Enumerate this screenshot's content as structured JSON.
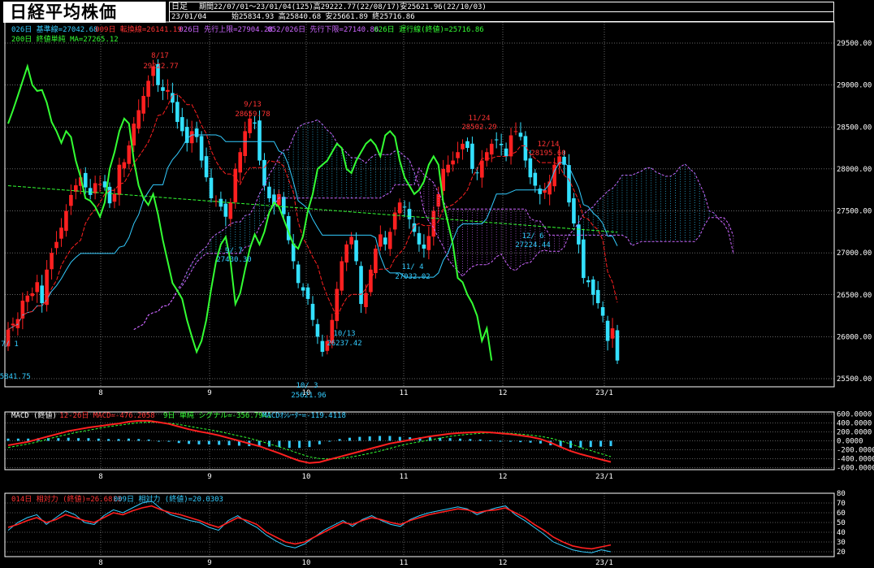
{
  "header": {
    "title": "日経平均株価",
    "period_type": "日足",
    "period_info": "期間22/07/01～23/01/04(125)高29222.77(22/08/17)安25621.96(22/10/03)",
    "date": "23/01/04",
    "ohlc": "始25834.93 高25840.68 安25661.89 終25716.86"
  },
  "legend_main": [
    {
      "text": "026日 基準線=27042.68",
      "color": "#33ccff"
    },
    {
      "text": "009日 転換線=26141.19",
      "color": "#ff3333"
    },
    {
      "text": "026日 先行上限=27904.28",
      "color": "#cc66ff"
    },
    {
      "text": "052/026日 先行下限=27140.86",
      "color": "#cc66ff"
    },
    {
      "text": "026日 遅行線(終値)=25716.86",
      "color": "#33ff33"
    },
    {
      "text": "200日 終値単純 MA=27265.12",
      "color": "#33ff33"
    }
  ],
  "legend_macd": [
    {
      "text": "MACD (終値)",
      "color": "#ffffff"
    },
    {
      "text": "12-26日 MACD=-476.2058",
      "color": "#ff3333"
    },
    {
      "text": "9日 単純 シグナル=-356.7941",
      "color": "#33ff33"
    },
    {
      "text": "MACDｵｼﾚｰﾀｰ=-119.4118",
      "color": "#33ccff"
    }
  ],
  "legend_rsi": [
    {
      "text": "014日 相対力 (終値)=26.6813",
      "color": "#ff3333"
    },
    {
      "text": "009日 相対力 (終値)=20.0303",
      "color": "#33ccff"
    }
  ],
  "colors": {
    "up": "#ff2020",
    "down": "#33e0ff",
    "kijun": "#33ccff",
    "tenkan": "#ff2020",
    "span_a": "#cc66ff",
    "span_b": "#cc66ff",
    "chikou": "#33ff33",
    "ma": "#33ff33",
    "grid": "#ffffff"
  },
  "chart_data": {
    "type": "candlestick",
    "y_axis": {
      "min": 25500,
      "max": 29500,
      "ticks": [
        "29500.00",
        "29000.00",
        "28500.00",
        "28000.00",
        "27500.00",
        "27000.00",
        "26500.00",
        "26000.00",
        "25500.00"
      ]
    },
    "x_ticks": [
      "8",
      "9",
      "10",
      "11",
      "12",
      "23/1"
    ],
    "annotations": [
      {
        "date_label": "8/17",
        "value_label": "29222.77",
        "color": "#ff3333"
      },
      {
        "date_label": "9/13",
        "value_label": "28659.78",
        "color": "#ff3333"
      },
      {
        "date_label": "11/24",
        "value_label": "28502.29",
        "color": "#ff3333"
      },
      {
        "date_label": "12/14",
        "value_label": "28195.60",
        "color": "#ff3333"
      },
      {
        "date_label": "9/ 7",
        "value_label": "27430.30",
        "color": "#33ccff"
      },
      {
        "date_label": "10/13",
        "value_label": "26237.42",
        "color": "#33ccff"
      },
      {
        "date_label": "10/ 3",
        "value_label": "25621.96",
        "color": "#33ccff"
      },
      {
        "date_label": "11/ 4",
        "value_label": "27032.02",
        "color": "#33ccff"
      },
      {
        "date_label": "12/ 6",
        "value_label": "27224.44",
        "color": "#33ccff"
      },
      {
        "date_label": "7/ 1",
        "value_label": "25841.75",
        "color": "#33ccff"
      }
    ],
    "closes": [
      26085,
      26155,
      26210,
      26430,
      26490,
      26517,
      26650,
      26400,
      26800,
      27000,
      27130,
      27300,
      27500,
      27690,
      27805,
      27900,
      27780,
      27690,
      27830,
      27820,
      27780,
      27590,
      27700,
      28050,
      28080,
      28280,
      28540,
      28700,
      28870,
      29050,
      29222,
      29000,
      28930,
      28940,
      28790,
      28560,
      28450,
      28310,
      28450,
      28380,
      28100,
      27900,
      27650,
      27620,
      27550,
      27430,
      27600,
      28000,
      28200,
      28450,
      28600,
      28540,
      28100,
      27800,
      27650,
      27570,
      27700,
      27460,
      27150,
      26900,
      26640,
      26550,
      26450,
      26200,
      26000,
      25820,
      25950,
      26200,
      26570,
      26900,
      27100,
      27190,
      26900,
      26390,
      26520,
      26800,
      27050,
      27220,
      27100,
      27250,
      27480,
      27600,
      27550,
      27400,
      27250,
      27100,
      27050,
      27200,
      27500,
      27700,
      28000,
      28050,
      28100,
      28200,
      28300,
      28250,
      28000,
      27950,
      28100,
      28200,
      28300,
      28350,
      28283,
      28150,
      28400,
      28450,
      28383,
      28100,
      27900,
      27800,
      27700,
      27750,
      27850,
      28050,
      28150,
      28050,
      27600,
      27350,
      27100,
      26700,
      26650,
      26500,
      26400,
      26250,
      25950,
      26100,
      25716
    ]
  },
  "macd_chart": {
    "ticks": [
      "600.0000",
      "400.0000",
      "200.0000",
      "0.0000",
      "-200.0000",
      "-400.0000",
      "-600.0000"
    ],
    "min": -650,
    "max": 650,
    "macd": [
      -100,
      -60,
      -20,
      40,
      100,
      160,
      220,
      260,
      300,
      330,
      360,
      390,
      430,
      450,
      450,
      420,
      380,
      320,
      260,
      210,
      170,
      120,
      60,
      0,
      -60,
      -120,
      -200,
      -280,
      -370,
      -450,
      -500,
      -480,
      -420,
      -360,
      -300,
      -240,
      -180,
      -120,
      -60,
      -20,
      20,
      60,
      100,
      130,
      160,
      180,
      190,
      200,
      190,
      170,
      150,
      120,
      90,
      40,
      -40,
      -140,
      -230,
      -300,
      -360,
      -420,
      -476
    ],
    "signal": [
      -150,
      -110,
      -70,
      -20,
      40,
      100,
      150,
      200,
      240,
      280,
      320,
      350,
      380,
      410,
      420,
      420,
      400,
      370,
      330,
      290,
      250,
      210,
      160,
      110,
      60,
      0,
      -70,
      -140,
      -210,
      -290,
      -360,
      -400,
      -410,
      -400,
      -370,
      -330,
      -280,
      -230,
      -170,
      -110,
      -60,
      -20,
      20,
      60,
      100,
      130,
      150,
      170,
      180,
      180,
      170,
      150,
      130,
      100,
      60,
      0,
      -70,
      -150,
      -220,
      -290,
      -356
    ]
  },
  "rsi_chart": {
    "ticks": [
      "80",
      "70",
      "60",
      "50",
      "40",
      "30",
      "20"
    ],
    "min": 15,
    "max": 80,
    "rsi14": [
      45,
      48,
      52,
      55,
      50,
      53,
      58,
      55,
      52,
      50,
      55,
      60,
      58,
      62,
      65,
      67,
      63,
      60,
      58,
      55,
      52,
      48,
      45,
      50,
      55,
      52,
      48,
      40,
      35,
      30,
      28,
      30,
      35,
      40,
      45,
      50,
      48,
      52,
      55,
      53,
      50,
      48,
      52,
      55,
      58,
      60,
      62,
      64,
      63,
      60,
      62,
      63,
      65,
      60,
      55,
      48,
      42,
      35,
      30,
      26,
      24,
      23,
      25,
      27
    ],
    "rsi9": [
      42,
      50,
      55,
      58,
      48,
      55,
      62,
      58,
      50,
      48,
      57,
      63,
      60,
      65,
      70,
      72,
      64,
      58,
      55,
      52,
      50,
      45,
      42,
      52,
      57,
      50,
      45,
      37,
      31,
      26,
      24,
      28,
      35,
      42,
      47,
      52,
      46,
      53,
      57,
      52,
      48,
      46,
      53,
      57,
      60,
      62,
      64,
      66,
      64,
      58,
      62,
      65,
      67,
      58,
      52,
      45,
      38,
      30,
      26,
      22,
      20,
      19,
      22,
      20
    ]
  }
}
